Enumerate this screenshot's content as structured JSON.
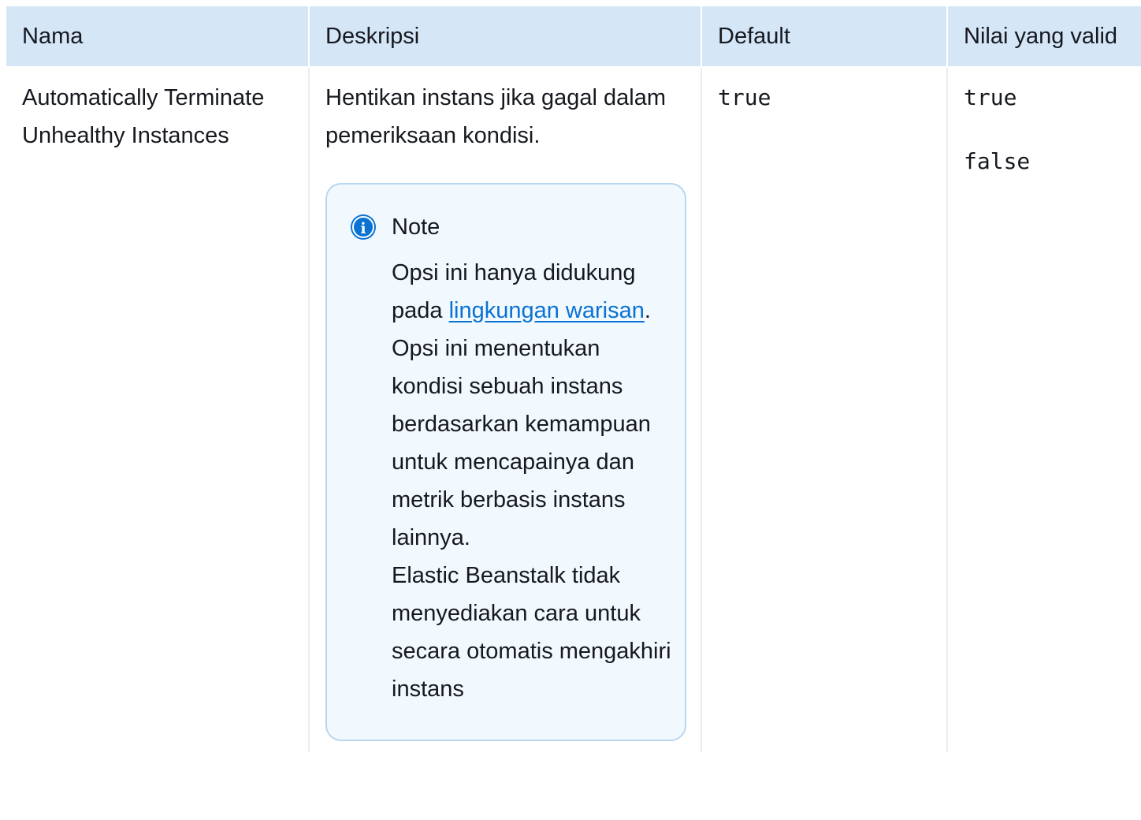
{
  "table": {
    "headers": [
      "Nama",
      "Deskripsi",
      "Default",
      "Nilai yang valid"
    ],
    "row": {
      "name": "Automatically Terminate Unhealthy Instances",
      "description": "Hentikan instans jika gagal dalam pemeriksaan kondisi.",
      "default": "true",
      "valid_values": [
        "true",
        "false"
      ]
    }
  },
  "note": {
    "icon": "info-icon",
    "title": "Note",
    "text_before_link": "Opsi ini hanya didukung pada ",
    "link_text": "lingkungan warisan",
    "text_after_link": ". Opsi ini menentukan kondisi sebuah instans berdasarkan kemampuan untuk mencapainya dan metrik berbasis instans lainnya.",
    "text_second": "Elastic Beanstalk tidak menyediakan cara untuk secara otomatis mengakhiri instans"
  },
  "colors": {
    "header_bg": "#d5e6f7",
    "note_bg": "#f1f8fe",
    "note_border": "#b7d6f0",
    "link": "#0972d3"
  }
}
